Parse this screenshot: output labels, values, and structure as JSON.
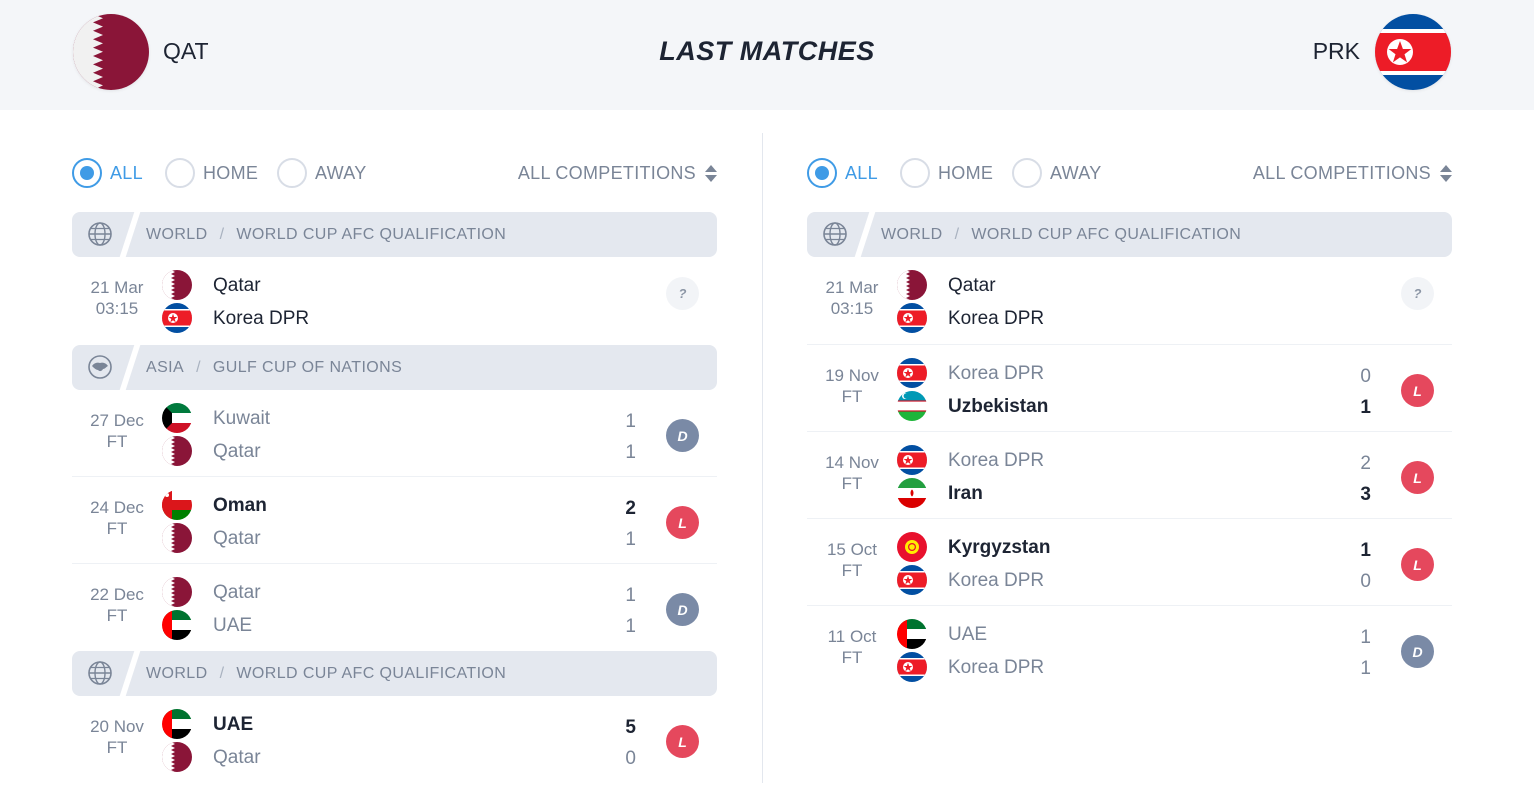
{
  "header": {
    "title": "LAST MATCHES",
    "home_code": "QAT",
    "away_code": "PRK"
  },
  "filters": {
    "all": "ALL",
    "home": "HOME",
    "away": "AWAY",
    "competitions": "ALL COMPETITIONS"
  },
  "left": {
    "groups": [
      {
        "region": "WORLD",
        "competition": "WORLD CUP AFC QUALIFICATION"
      },
      {
        "region": "ASIA",
        "competition": "GULF CUP OF NATIONS"
      },
      {
        "region": "WORLD",
        "competition": "WORLD CUP AFC QUALIFICATION"
      }
    ],
    "matches": [
      {
        "date": "21 Mar",
        "time": "03:15",
        "team1": "Qatar",
        "team2": "Korea DPR",
        "score1": "",
        "score2": "",
        "result": "?"
      },
      {
        "date": "27 Dec",
        "time": "FT",
        "team1": "Kuwait",
        "team2": "Qatar",
        "score1": "1",
        "score2": "1",
        "result": "D"
      },
      {
        "date": "24 Dec",
        "time": "FT",
        "team1": "Oman",
        "team2": "Qatar",
        "score1": "2",
        "score2": "1",
        "result": "L"
      },
      {
        "date": "22 Dec",
        "time": "FT",
        "team1": "Qatar",
        "team2": "UAE",
        "score1": "1",
        "score2": "1",
        "result": "D"
      },
      {
        "date": "20 Nov",
        "time": "FT",
        "team1": "UAE",
        "team2": "Qatar",
        "score1": "5",
        "score2": "0",
        "result": "L"
      }
    ]
  },
  "right": {
    "groups": [
      {
        "region": "WORLD",
        "competition": "WORLD CUP AFC QUALIFICATION"
      }
    ],
    "matches": [
      {
        "date": "21 Mar",
        "time": "03:15",
        "team1": "Qatar",
        "team2": "Korea DPR",
        "score1": "",
        "score2": "",
        "result": "?"
      },
      {
        "date": "19 Nov",
        "time": "FT",
        "team1": "Korea DPR",
        "team2": "Uzbekistan",
        "score1": "0",
        "score2": "1",
        "result": "L"
      },
      {
        "date": "14 Nov",
        "time": "FT",
        "team1": "Korea DPR",
        "team2": "Iran",
        "score1": "2",
        "score2": "3",
        "result": "L"
      },
      {
        "date": "15 Oct",
        "time": "FT",
        "team1": "Kyrgyzstan",
        "team2": "Korea DPR",
        "score1": "1",
        "score2": "0",
        "result": "L"
      },
      {
        "date": "11 Oct",
        "time": "FT",
        "team1": "UAE",
        "team2": "Korea DPR",
        "score1": "1",
        "score2": "1",
        "result": "D"
      }
    ]
  },
  "colors": {
    "accent": "#3f9be6",
    "loss": "#e5485d",
    "draw": "#7a8aa6",
    "muted": "#7a8597"
  },
  "icons": [
    "globe-icon",
    "asia-map-icon",
    "sort-icon",
    "flag-icons"
  ]
}
